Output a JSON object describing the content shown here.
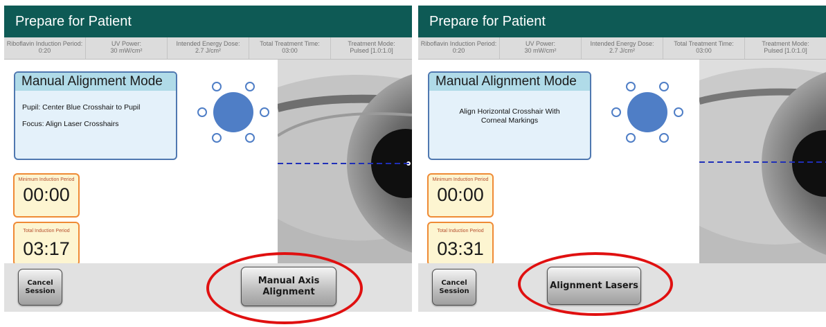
{
  "colors": {
    "header_bg": "#0e5a55",
    "infobox_bg": "#e4f1fa",
    "infobox_title_bg": "#b0dbe8",
    "target_blue": "#4f7ec6",
    "timer_border": "#ef8a35",
    "timer_bg": "#fdf5d1",
    "highlight_ring": "#e01010",
    "crosshair": "#1f2fb8"
  },
  "panels": [
    {
      "header_title": "Prepare for Patient",
      "params": [
        {
          "label": "Riboflavin Induction Period:",
          "value": "0:20"
        },
        {
          "label": "UV Power:",
          "value": "30 mW/cm²"
        },
        {
          "label": "Intended Energy Dose:",
          "value": "2.7 J/cm²"
        },
        {
          "label": "Total Treatment Time:",
          "value": "03:00"
        },
        {
          "label": "Treatment Mode:",
          "value": "Pulsed [1.0:1.0]"
        }
      ],
      "mode_title": "Manual Alignment Mode",
      "instructions": [
        "Pupil: Center Blue Crosshair to Pupil",
        "Focus: Align Laser Crosshairs"
      ],
      "min_induction_label": "Minimum Induction Period",
      "min_induction_value": "00:00",
      "total_induction_label": "Total Induction Period",
      "total_induction_value": "03:17",
      "cancel_label": "Cancel Session",
      "action_label": "Manual Axis Alignment",
      "target_icon": "alignment-target-icon",
      "eye_icon": "eye-image"
    },
    {
      "header_title": "Prepare for Patient",
      "params": [
        {
          "label": "Riboflavin Induction Period:",
          "value": "0:20"
        },
        {
          "label": "UV Power:",
          "value": "30 mW/cm²"
        },
        {
          "label": "Intended Energy Dose:",
          "value": "2.7 J/cm²"
        },
        {
          "label": "Total Treatment Time:",
          "value": "03:00"
        },
        {
          "label": "Treatment Mode:",
          "value": "Pulsed [1.0:1.0]"
        }
      ],
      "mode_title": "Manual Alignment Mode",
      "instructions": [
        "Align Horizontal Crosshair With Corneal Markings"
      ],
      "min_induction_label": "Minimum Induction Period",
      "min_induction_value": "00:00",
      "total_induction_label": "Total Induction Period",
      "total_induction_value": "03:31",
      "cancel_label": "Cancel Session",
      "action_label": "Alignment Lasers",
      "target_icon": "alignment-target-icon",
      "eye_icon": "eye-image"
    }
  ]
}
